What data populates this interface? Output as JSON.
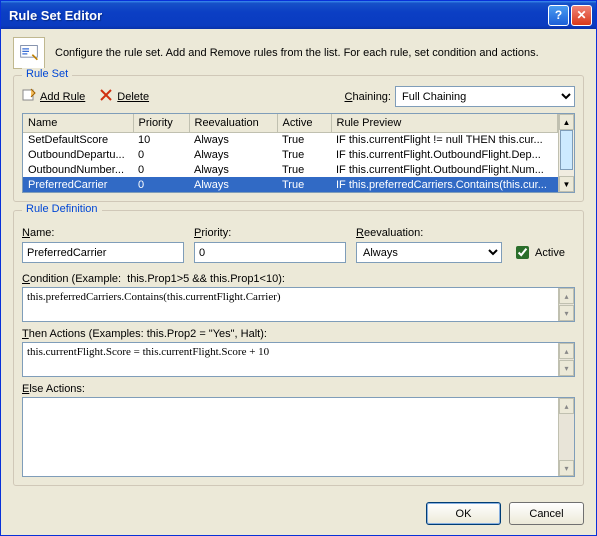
{
  "window": {
    "title": "Rule Set Editor"
  },
  "intro": "Configure the rule set. Add and Remove rules from the list. For each rule, set condition and actions.",
  "ruleset": {
    "legend": "Rule Set",
    "add_label": "Add Rule",
    "delete_label": "Delete",
    "chaining_label": "Chaining:",
    "chaining_value": "Full Chaining",
    "columns": {
      "name": "Name",
      "priority": "Priority",
      "reeval": "Reevaluation",
      "active": "Active",
      "preview": "Rule Preview"
    },
    "rows": [
      {
        "name": "SetDefaultScore",
        "priority": "10",
        "reeval": "Always",
        "active": "True",
        "preview": "IF this.currentFlight != null THEN this.cur..."
      },
      {
        "name": "OutboundDepartu...",
        "priority": "0",
        "reeval": "Always",
        "active": "True",
        "preview": "IF this.currentFlight.OutboundFlight.Dep..."
      },
      {
        "name": "OutboundNumber...",
        "priority": "0",
        "reeval": "Always",
        "active": "True",
        "preview": "IF this.currentFlight.OutboundFlight.Num..."
      },
      {
        "name": "PreferredCarrier",
        "priority": "0",
        "reeval": "Always",
        "active": "True",
        "preview": "IF this.preferredCarriers.Contains(this.cur..."
      }
    ],
    "selected_index": 3
  },
  "definition": {
    "legend": "Rule Definition",
    "name_label": "Name:",
    "name_value": "PreferredCarrier",
    "priority_label": "Priority:",
    "priority_value": "0",
    "reeval_label": "Reevaluation:",
    "reeval_value": "Always",
    "active_label": "Active",
    "active_checked": true,
    "condition_label": "Condition (Example:  this.Prop1>5 && this.Prop1<10):",
    "condition_value": "this.preferredCarriers.Contains(this.currentFlight.Carrier)",
    "then_label": "Then Actions (Examples: this.Prop2 = \"Yes\", Halt):",
    "then_value": "this.currentFlight.Score = this.currentFlight.Score + 10",
    "else_label": "Else Actions:",
    "else_value": ""
  },
  "footer": {
    "ok": "OK",
    "cancel": "Cancel"
  }
}
